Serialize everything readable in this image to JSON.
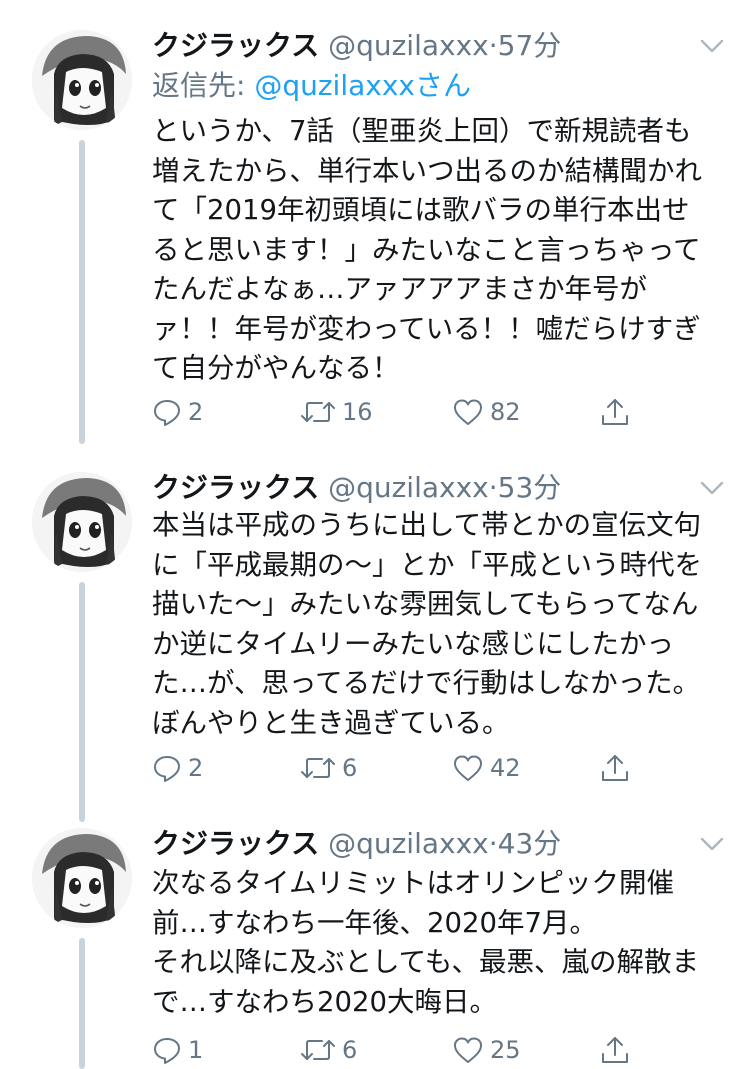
{
  "tweets": [
    {
      "name": "クジラックス",
      "handle": "@quzilaxxx",
      "time": "57分",
      "reply_prefix": "返信先: ",
      "reply_mention": "@quzilaxxxさん",
      "lines": [
        "というか、7話（聖亜炎上回）で新規読者も",
        "増えたから、単行本いつ出るのか結構聞かれ",
        "て「2019年初頭頃には歌バラの単行本出せ",
        "ると思います！」みたいなこと言っちゃって",
        "たんだよなぁ…アァアアアまさか年号が",
        "ァ！！年号が変わっている！！嘘だらけすぎ",
        "て自分がやんなる！"
      ],
      "replies": "2",
      "retweets": "16",
      "likes": "82"
    },
    {
      "name": "クジラックス",
      "handle": "@quzilaxxx",
      "time": "53分",
      "lines": [
        "本当は平成のうちに出して帯とかの宣伝文句",
        "に「平成最期の〜」とか「平成という時代を",
        "描いた〜」みたいな雰囲気してもらってなん",
        "か逆にタイムリーみたいな感じにしたかっ",
        "た…が、思ってるだけで行動はしなかった。",
        "ぼんやりと生き過ぎている。"
      ],
      "replies": "2",
      "retweets": "6",
      "likes": "42"
    },
    {
      "name": "クジラックス",
      "handle": "@quzilaxxx",
      "time": "43分",
      "lines": [
        "次なるタイムリミットはオリンピック開催",
        "前…すなわち一年後、2020年7月。",
        "それ以降に及ぶとしても、最悪、嵐の解散ま",
        "で…すなわち2020大晦日。"
      ],
      "replies": "1",
      "retweets": "6",
      "likes": "25"
    }
  ],
  "colors": {
    "text": "#14171a",
    "secondary": "#657786",
    "link": "#1da1f2",
    "thread_line": "#c8d3dc"
  },
  "icons": [
    "avatar-illustration",
    "chevron-down-icon",
    "reply-icon",
    "retweet-icon",
    "like-icon",
    "share-icon"
  ]
}
